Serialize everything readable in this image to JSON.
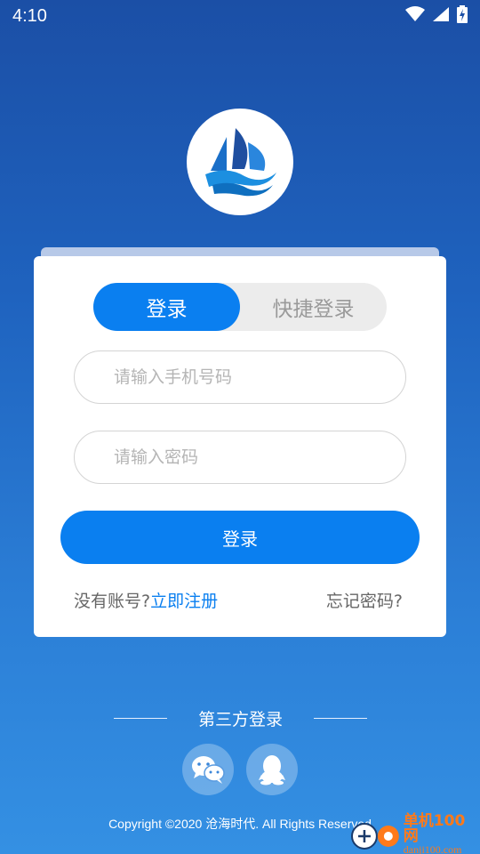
{
  "status_bar": {
    "time": "4:10"
  },
  "login_tabs": {
    "active": "登录",
    "inactive": "快捷登录"
  },
  "form": {
    "phone_placeholder": "请输入手机号码",
    "password_placeholder": "请输入密码",
    "submit_label": "登录"
  },
  "links": {
    "no_account": "没有账号?",
    "register": "立即注册",
    "forgot": "忘记密码?"
  },
  "third_party": {
    "title": "第三方登录",
    "providers": [
      "wechat-icon",
      "qq-icon"
    ]
  },
  "footer": {
    "copyright": "Copyright ©2020 沧海时代. All Rights Reserved"
  },
  "watermark": {
    "cn": "单机100网",
    "en": "danji100.com"
  },
  "colors": {
    "primary": "#0a7ff0",
    "bg_top": "#1b4fa6",
    "bg_bottom": "#3490e3",
    "watermark": "#ff7a1a"
  }
}
